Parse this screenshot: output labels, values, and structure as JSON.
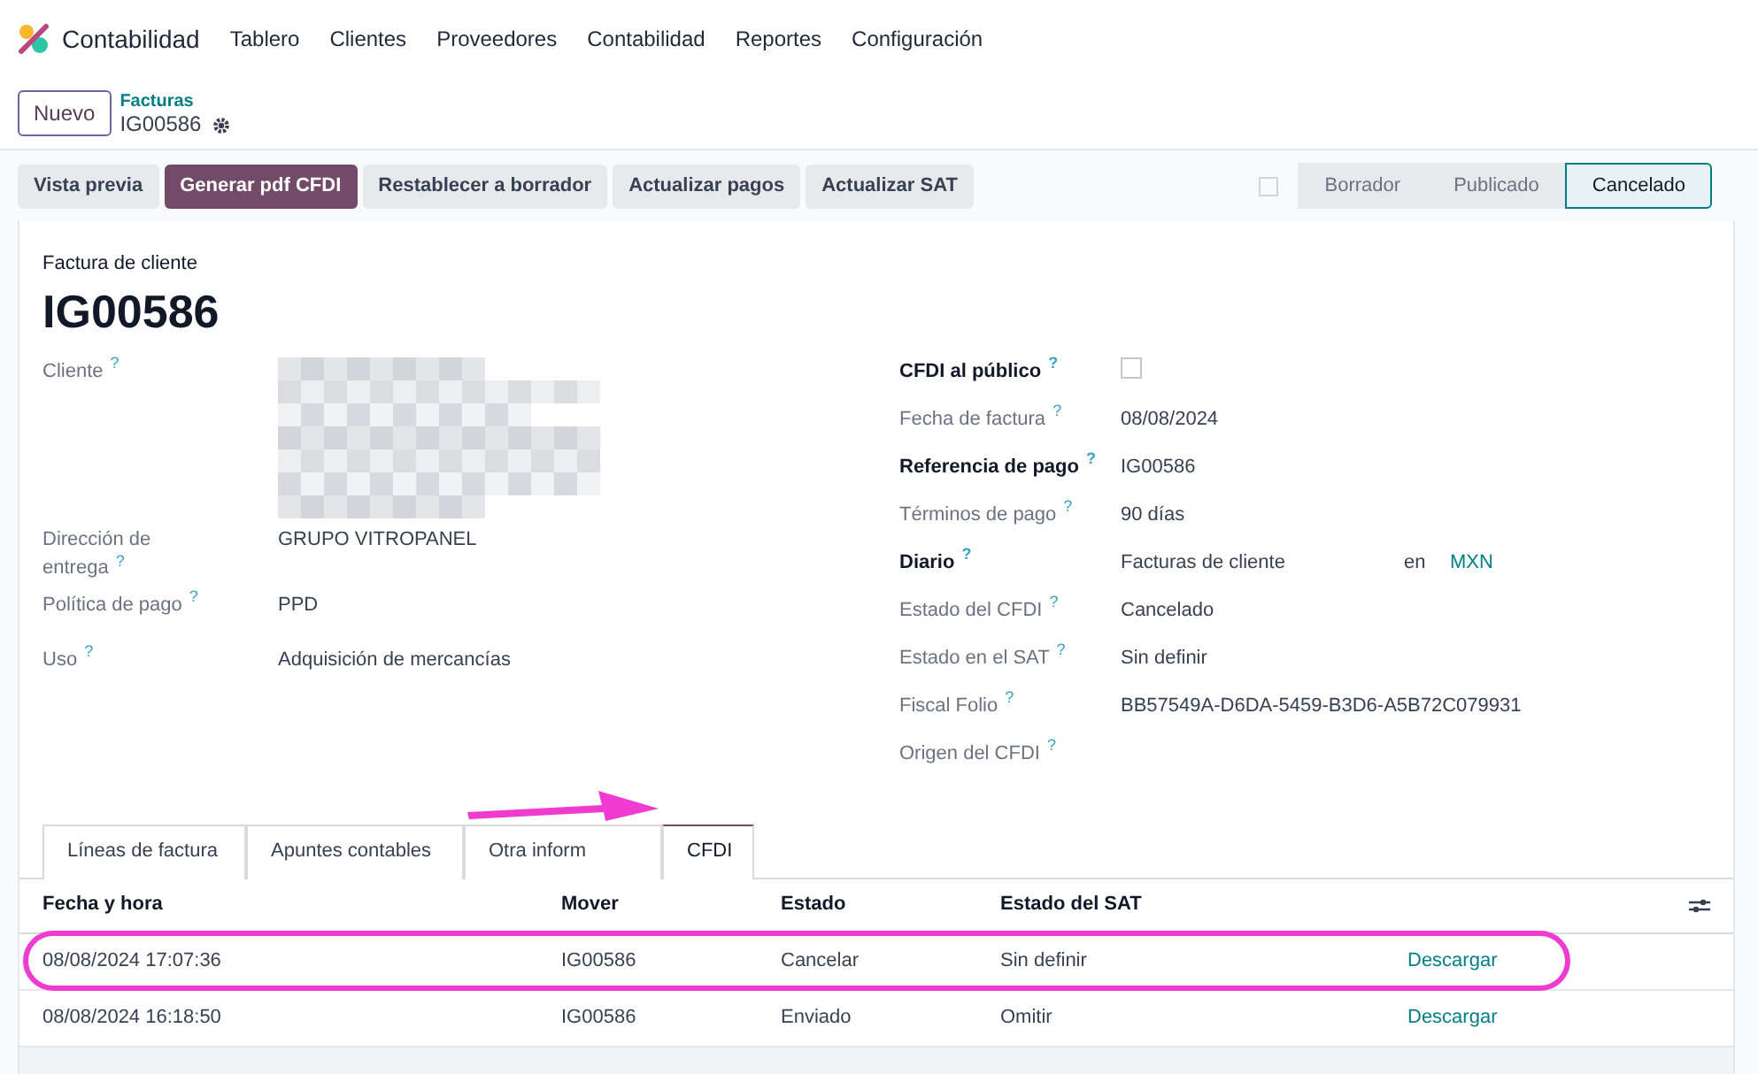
{
  "app": {
    "name": "Contabilidad"
  },
  "menu": [
    "Tablero",
    "Clientes",
    "Proveedores",
    "Contabilidad",
    "Reportes",
    "Configuración"
  ],
  "breadcrumb": {
    "new_button": "Nuevo",
    "parent": "Facturas",
    "current": "IG00586"
  },
  "actions": [
    {
      "label": "Vista previa",
      "primary": false
    },
    {
      "label": "Generar pdf CFDI",
      "primary": true
    },
    {
      "label": "Restablecer a borrador",
      "primary": false
    },
    {
      "label": "Actualizar pagos",
      "primary": false
    },
    {
      "label": "Actualizar SAT",
      "primary": false
    }
  ],
  "control_checkbox": {
    "checked": false
  },
  "stages": [
    {
      "label": "Borrador",
      "selected": false
    },
    {
      "label": "Publicado",
      "selected": false
    },
    {
      "label": "Cancelado",
      "selected": true
    }
  ],
  "form": {
    "type": "Factura de cliente",
    "number": "IG00586",
    "left": [
      {
        "label": "Cliente",
        "help": "?",
        "kind": "redacted",
        "required": false
      },
      {
        "label": "Dirección de entrega",
        "help": "?",
        "value": "GRUPO VITROPANEL",
        "kind": "text",
        "required": false
      },
      {
        "label": "Política de pago",
        "help": "?",
        "value": "PPD",
        "kind": "text",
        "required": false
      },
      {
        "label": "Uso",
        "help": "?",
        "value": "Adquisición de mercancías",
        "kind": "text",
        "required": false
      }
    ],
    "right": [
      {
        "label": "CFDI al público",
        "help": "?",
        "kind": "checkbox",
        "checked": false,
        "required": true
      },
      {
        "label": "Fecha de factura",
        "help": "?",
        "value": "08/08/2024",
        "kind": "text",
        "required": false
      },
      {
        "label": "Referencia de pago",
        "help": "?",
        "value": "IG00586",
        "kind": "text",
        "required": true
      },
      {
        "label": "Términos de pago",
        "help": "?",
        "value": "90 días",
        "kind": "text",
        "required": false
      },
      {
        "label": "Diario",
        "help": "?",
        "value": "Facturas de cliente",
        "joiner": "en",
        "currency": "MXN",
        "kind": "journal",
        "required": true
      },
      {
        "label": "Estado del CFDI",
        "help": "?",
        "value": "Cancelado",
        "kind": "text",
        "required": false
      },
      {
        "label": "Estado en el SAT",
        "help": "?",
        "value": "Sin definir",
        "kind": "text",
        "required": false
      },
      {
        "label": "Fiscal Folio",
        "help": "?",
        "value": "BB57549A-D6DA-5459-B3D6-A5B72C079931",
        "kind": "text",
        "required": false
      },
      {
        "label": "Origen del CFDI",
        "help": "?",
        "kind": "empty",
        "required": false
      }
    ]
  },
  "tabs": [
    {
      "label": "Líneas de factura",
      "selected": false
    },
    {
      "label": "Apuntes contables",
      "selected": false
    },
    {
      "label": "Otra inform",
      "selected": false
    },
    {
      "label": "CFDI",
      "selected": true
    }
  ],
  "table": {
    "columns": [
      "Fecha y hora",
      "Mover",
      "Estado",
      "Estado del SAT"
    ],
    "rows": [
      {
        "cells": [
          "08/08/2024 17:07:36",
          "IG00586",
          "Cancelar",
          "Sin definir"
        ],
        "link": "Descargar",
        "highlighted": true
      },
      {
        "cells": [
          "08/08/2024 16:18:50",
          "IG00586",
          "Enviado",
          "Omitir"
        ],
        "link": "Descargar",
        "highlighted": false
      }
    ]
  }
}
